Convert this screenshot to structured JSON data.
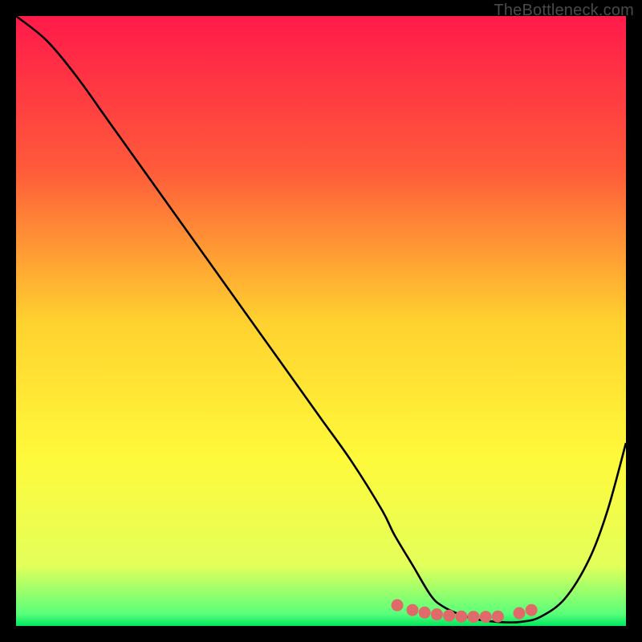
{
  "watermark": "TheBottleneck.com",
  "chart_data": {
    "type": "line",
    "title": "",
    "xlabel": "",
    "ylabel": "",
    "xlim": [
      0,
      100
    ],
    "ylim": [
      0,
      100
    ],
    "grid": false,
    "legend": false,
    "gradient_stops": [
      {
        "offset": 0,
        "color": "#ff1a4a"
      },
      {
        "offset": 25,
        "color": "#ff5a3a"
      },
      {
        "offset": 50,
        "color": "#ffd12f"
      },
      {
        "offset": 72,
        "color": "#fff93a"
      },
      {
        "offset": 90,
        "color": "#e4ff5a"
      },
      {
        "offset": 98,
        "color": "#5aff7a"
      },
      {
        "offset": 100,
        "color": "#00e85c"
      }
    ],
    "series": [
      {
        "name": "bottleneck-curve",
        "color": "#000000",
        "x": [
          0,
          5,
          10,
          15,
          20,
          25,
          30,
          35,
          40,
          45,
          50,
          55,
          60,
          62,
          65,
          68,
          70,
          73,
          76,
          80,
          83,
          86,
          90,
          94,
          97,
          100
        ],
        "y": [
          100,
          96,
          90,
          83,
          76,
          69,
          62,
          55,
          48,
          41,
          34,
          27,
          19,
          15,
          10,
          5,
          3.2,
          1.8,
          1.0,
          0.6,
          0.7,
          1.5,
          4.5,
          11,
          19,
          30
        ]
      }
    ],
    "markers": {
      "name": "highlight-dots",
      "color": "#e06a6a",
      "radius": 7.5,
      "points": [
        {
          "x": 62.5,
          "y": 3.4
        },
        {
          "x": 65.0,
          "y": 2.6
        },
        {
          "x": 67.0,
          "y": 2.2
        },
        {
          "x": 69.0,
          "y": 1.9
        },
        {
          "x": 71.0,
          "y": 1.7
        },
        {
          "x": 73.0,
          "y": 1.55
        },
        {
          "x": 75.0,
          "y": 1.5
        },
        {
          "x": 77.0,
          "y": 1.5
        },
        {
          "x": 79.0,
          "y": 1.55
        },
        {
          "x": 82.5,
          "y": 2.1
        },
        {
          "x": 84.5,
          "y": 2.6
        }
      ]
    }
  }
}
